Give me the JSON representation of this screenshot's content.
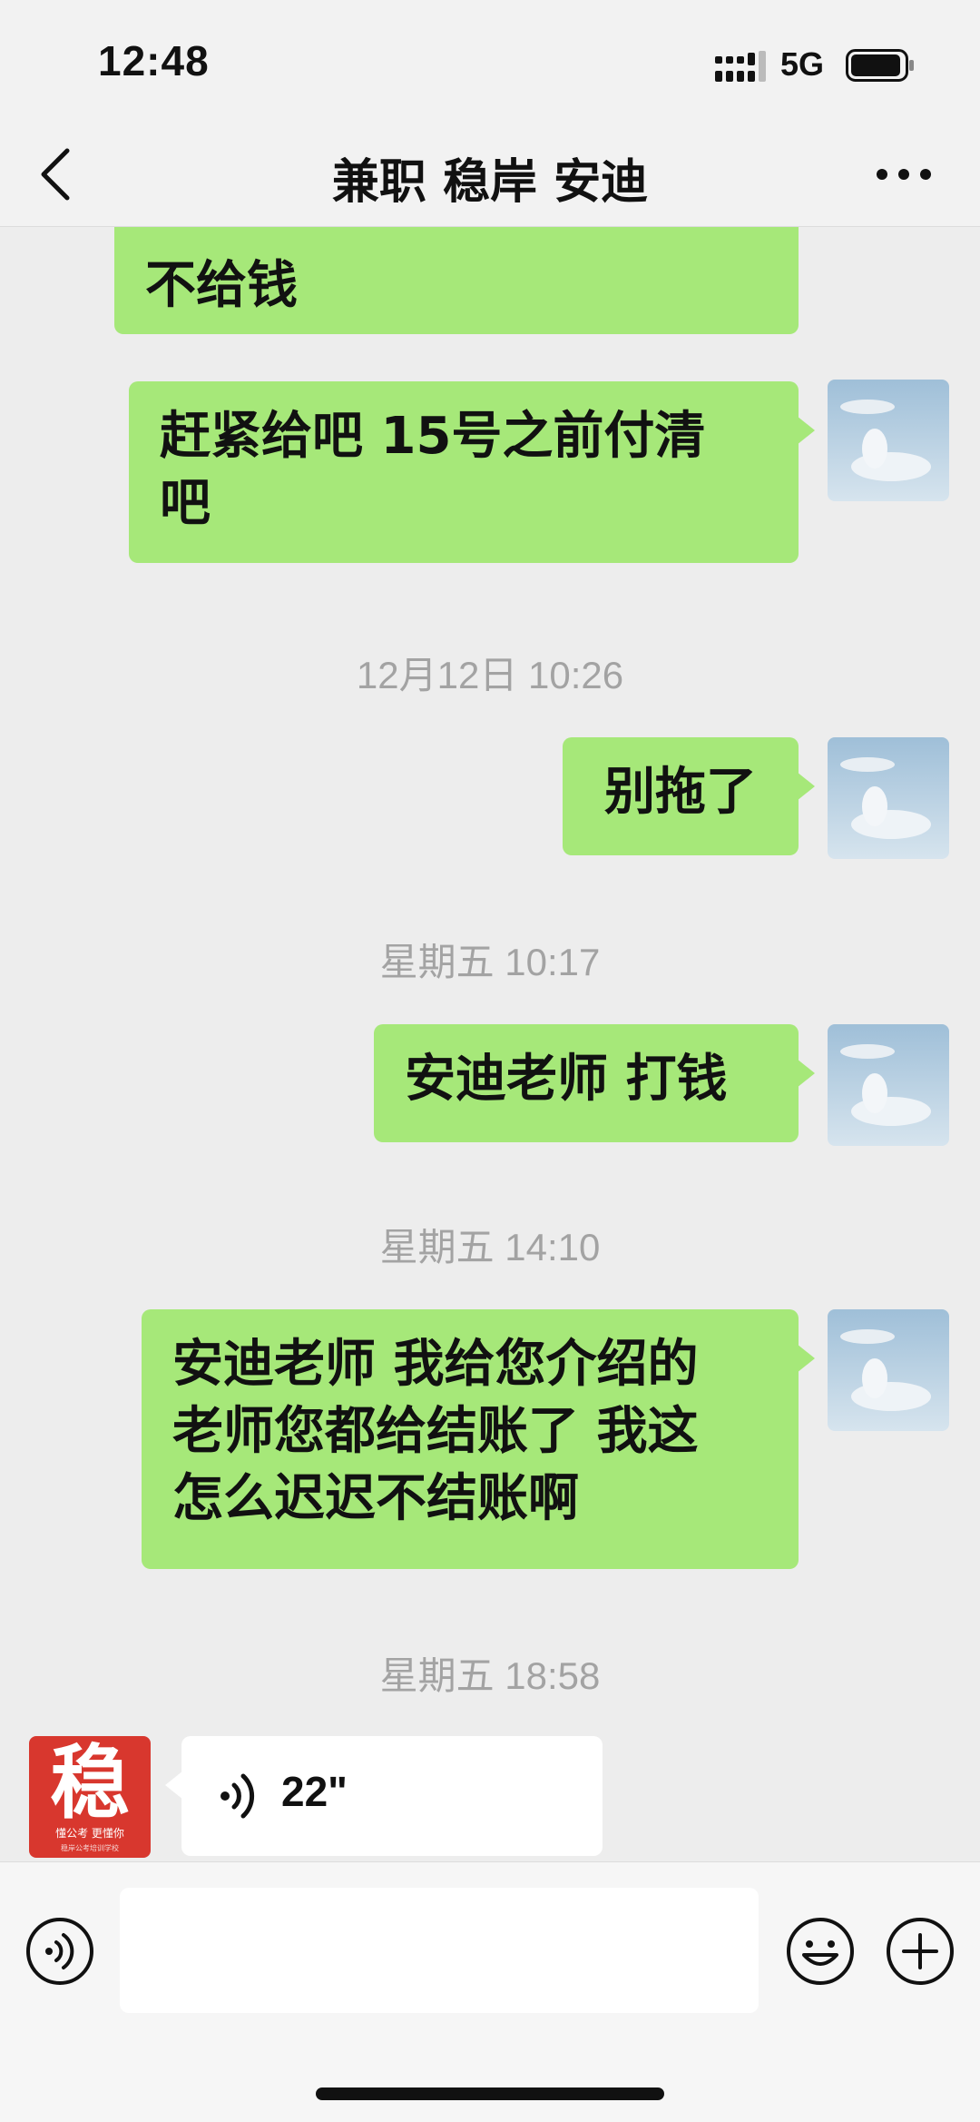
{
  "status_bar": {
    "time": "12:48",
    "network": "5G"
  },
  "header": {
    "title": "兼职 稳岸 安迪"
  },
  "messages": {
    "partial_bubble": {
      "line2": "不给钱"
    },
    "m1": {
      "line1": "赶紧给吧 15号之前付清",
      "line2": "吧"
    },
    "ts1": "12月12日 10:26",
    "m2": "别拖了",
    "ts2": "星期五 10:17",
    "m3": "安迪老师 打钱",
    "ts3": "星期五 14:10",
    "m4": {
      "line1": "安迪老师 我给您介绍的",
      "line2": "老师您都给结账了 我这",
      "line3": "怎么迟迟不结账啊"
    },
    "ts4": "星期五 18:58",
    "voice": {
      "duration": "22\""
    }
  },
  "other_avatar": {
    "glyph": "稳",
    "tagline": "懂公考 更懂你",
    "footer": "稳岸公考培训学校"
  },
  "colors": {
    "sent_bubble": "#a6e879",
    "background": "#ededed",
    "received_bubble": "#ffffff",
    "brand_red": "#d8372e"
  },
  "icons": [
    "signal-icon",
    "battery-icon",
    "back-icon",
    "more-icon",
    "voice-wave-icon",
    "voice-toggle-icon",
    "emoji-icon",
    "plus-icon"
  ]
}
